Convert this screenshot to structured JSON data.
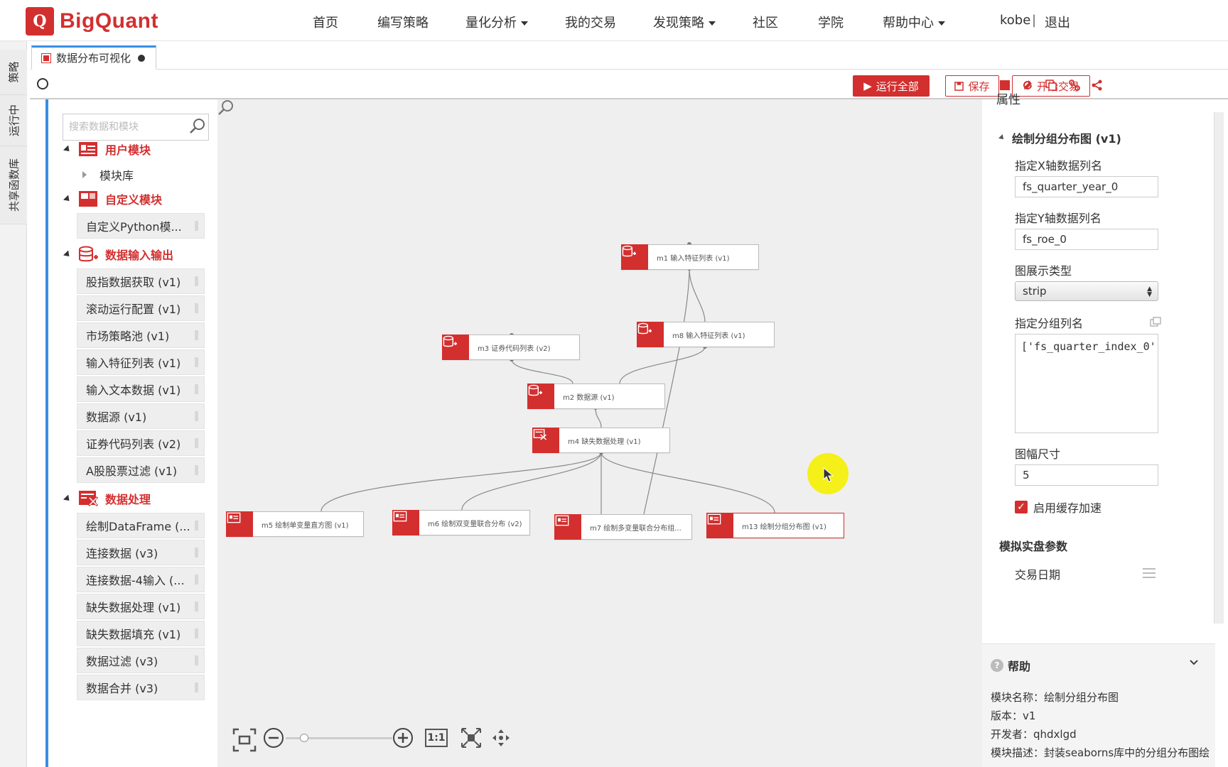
{
  "brand": {
    "mark": "Q",
    "name": "BigQuant"
  },
  "nav": {
    "items": [
      {
        "label": "首页",
        "dropdown": false
      },
      {
        "label": "编写策略",
        "dropdown": false
      },
      {
        "label": "量化分析",
        "dropdown": true
      },
      {
        "label": "我的交易",
        "dropdown": false
      },
      {
        "label": "发现策略",
        "dropdown": true
      },
      {
        "label": "社区",
        "dropdown": false
      },
      {
        "label": "学院",
        "dropdown": false
      },
      {
        "label": "帮助中心",
        "dropdown": true
      }
    ],
    "user": "kobe",
    "separator": "|",
    "logout": "退出"
  },
  "side_tabs": [
    "策略",
    "运行中",
    "共享函数库"
  ],
  "document_tab": {
    "title": "数据分布可视化"
  },
  "toolbar": {
    "run_all": "运行全部",
    "save": "保存",
    "start_trade": "开始交易",
    "icons": [
      "stop-icon",
      "refresh-icon",
      "copy-icon",
      "link-icon",
      "share-icon"
    ]
  },
  "library": {
    "search_placeholder": "搜索数据和模块",
    "groups": [
      {
        "label": "用户模块",
        "sub": "模块库"
      },
      {
        "label": "自定义模块",
        "items": [
          "自定义Python模..."
        ]
      },
      {
        "label": "数据输入输出",
        "items": [
          "股指数据获取 (v1)",
          "滚动运行配置 (v1)",
          "市场策略池 (v1)",
          "输入特征列表 (v1)",
          "输入文本数据 (v1)",
          "数据源 (v1)",
          "证券代码列表 (v2)",
          "A股股票过滤 (v1)"
        ]
      },
      {
        "label": "数据处理",
        "items": [
          "绘制DataFrame (...",
          "连接数据 (v3)",
          "连接数据-4输入 (...",
          "缺失数据处理 (v1)",
          "缺失数据填充 (v1)",
          "数据过滤 (v3)",
          "数据合并 (v3)"
        ]
      }
    ]
  },
  "canvas": {
    "nodes": [
      {
        "id": "m1",
        "label": "m1 输入特征列表 (v1)",
        "icon": "database-add-icon"
      },
      {
        "id": "m8",
        "label": "m8 输入特征列表 (v1)",
        "icon": "database-add-icon"
      },
      {
        "id": "m3",
        "label": "m3 证券代码列表 (v2)",
        "icon": "database-add-icon"
      },
      {
        "id": "m2",
        "label": "m2 数据源 (v1)",
        "icon": "database-add-icon"
      },
      {
        "id": "m4",
        "label": "m4 缺失数据处理 (v1)",
        "icon": "data-process-icon"
      },
      {
        "id": "m5",
        "label": "m5 绘制单变量直方图 (v1)",
        "icon": "user-card-icon"
      },
      {
        "id": "m6",
        "label": "m6 绘制双变量联合分布 (v2)",
        "icon": "user-card-icon"
      },
      {
        "id": "m7",
        "label": "m7 绘制多变量联合分布组...",
        "icon": "user-card-icon"
      },
      {
        "id": "m13",
        "label": "m13 绘制分组分布图 (v1)",
        "icon": "user-card-icon"
      }
    ],
    "zoom": {
      "reset_label": "1:1",
      "level": 0.5
    }
  },
  "properties": {
    "title": "属性",
    "section": "绘制分组分布图 (v1)",
    "x_label": "指定X轴数据列名",
    "x_value": "fs_quarter_year_0",
    "y_label": "指定Y轴数据列名",
    "y_value": "fs_roe_0",
    "chart_type_label": "图展示类型",
    "chart_type_value": "strip",
    "group_label": "指定分组列名",
    "group_value": "['fs_quarter_index_0'",
    "size_label": "图幅尺寸",
    "size_value": "5",
    "cache_label": "启用缓存加速",
    "cache_checked": true,
    "sim_section": "模拟实盘参数",
    "trade_date_label": "交易日期"
  },
  "help": {
    "title": "帮助",
    "lines": [
      "模块名称：绘制分组分布图",
      "版本：v1",
      "开发者：qhdxlgd",
      "模块描述：封装seaborns库中的分组分布图绘"
    ]
  },
  "colors": {
    "brand": "#d32f2f",
    "accent_blue": "#3a8ee6",
    "canvas_bg": "#efefef"
  }
}
